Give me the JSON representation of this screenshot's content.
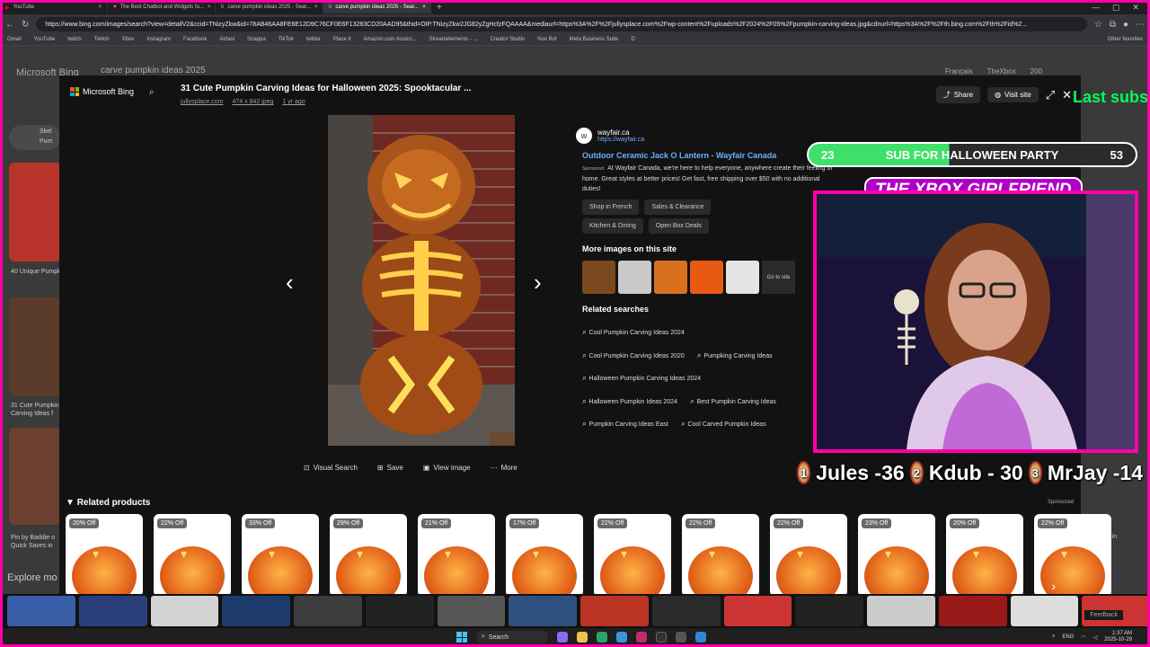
{
  "browser": {
    "tabs": [
      {
        "label": "YouTube",
        "active": false
      },
      {
        "label": "The Best Chatbot and Widgets fo...",
        "active": false
      },
      {
        "label": "carve pumpkin ideas 2025 - Sear...",
        "active": false
      },
      {
        "label": "carve pumpkin ideas 2025 - Sear...",
        "active": true
      }
    ],
    "new_tab": "+",
    "url": "https://www.bing.com/images/search?view=detailV2&ccid=TNizyZkw&id=78AB46AA8FE6E12D9C76CF0E6F13283CD20AAD95&thid=OIP.TNizyZkw2JG82yZgHcfzFQAAAA&mediaurl=https%3A%2F%2Fjullysplace.com%2Fwp-content%2Fuploads%2F2024%2F05%2Fpumpkin-carving-ideas.jpg&cdnurl=https%3A%2F%2Fth.bing.com%2Fth%2Fid%2...",
    "bookmarks": [
      "Gmail",
      "YouTube",
      "twitch",
      "Twitch",
      "Xbox",
      "Instagram",
      "Facebook",
      "Airtasl",
      "Snappa",
      "TikTok",
      "twitter",
      "Place it",
      "Amazon.com Associ...",
      "Streamelements - ...",
      "Creator Studio",
      "Nox Bot",
      "Meta Business Suite",
      "D"
    ],
    "other_bookmarks": "Other favorites"
  },
  "bing_bg": {
    "logo": "Microsoft Bing",
    "query": "carve pumpkin ideas 2025",
    "lang": "Français",
    "user": "TheXbox",
    "points": "200",
    "left_labels": [
      "Skel",
      "Pum",
      "40 Unique Pumpkin",
      "31 Cute Pumpkin Carving Ideas f",
      "Pin by Baddie o Quick Saves in",
      "Explore mo"
    ],
    "right_label": "01 Best in"
  },
  "lightbox": {
    "brand": "Microsoft Bing",
    "title": "31 Cute Pumpkin Carving Ideas for Halloween 2025: Spooktacular ...",
    "source": "jullysplace.com",
    "dimensions": "474 x 842 jpeg",
    "age": "1 yr ago",
    "share_label": "Share",
    "visit_label": "Visit site",
    "tools": [
      "Visual Search",
      "Save",
      "View image",
      "More"
    ]
  },
  "ad": {
    "favicon_letter": "w",
    "name": "wayfair.ca",
    "url": "https://wayfair.ca",
    "title": "Outdoor Ceramic Jack O Lantern - Wayfair Canada",
    "sponsored": "Sponsored",
    "description": "At Wayfair Canada, we're here to help everyone, anywhere create their feeling of home. Great styles at better prices! Get fast, free shipping over $50 with no additional duties!",
    "chips": [
      "Shop in French",
      "Sales & Clearance",
      "Kitchen & Dining",
      "Open Box Deals"
    ]
  },
  "more_images": {
    "heading": "More images on this site",
    "go_to_site": "Go to site",
    "thumb_colors": [
      "#7a4a1e",
      "#c9c9c9",
      "#d8701e",
      "#e85a12",
      "#e4e4e4"
    ]
  },
  "related_searches": {
    "heading": "Related searches",
    "rows": [
      [
        "Cool Pumpkin Carving Ideas 2024"
      ],
      [
        "Cool Pumpkin Carving Ideas 2020",
        "Pumpking Carving Ideas"
      ],
      [
        "Halloween Pumpkin Carving Ideas 2024"
      ],
      [
        "Halloween Pumpkin Ideas 2024",
        "Best Pumpkin Carving Ideas"
      ],
      [
        "Pumpkin Carving Ideas East",
        "Cool Carved Pumpkin Ideas"
      ]
    ]
  },
  "related_products": {
    "heading": "Related products",
    "sponsored": "Sponsored",
    "discounts": [
      "20% Off",
      "22% Off",
      "33% Off",
      "29% Off",
      "21% Off",
      "17% Off",
      "22% Off",
      "22% Off",
      "22% Off",
      "23% Off",
      "20% Off",
      "22% Off"
    ]
  },
  "overlay": {
    "last_sub": "Last subs",
    "goal_current": "23",
    "goal_text": "SUB FOR HALLOWEEN PARTY",
    "goal_target": "53",
    "goal_progress": 0.43,
    "brand_banner": "THE XBOX GIRLFRIEND",
    "leaders": [
      {
        "rank": "1",
        "text": "Jules -36"
      },
      {
        "rank": "2",
        "text": "Kdub - 30"
      },
      {
        "rank": "3",
        "text": "MrJay -14"
      }
    ]
  },
  "bottom": {
    "strip_colors": [
      "#3a5da8",
      "#2a3f7a",
      "#d3d3d3",
      "#1d3a6d",
      "#3d3d3d",
      "#222",
      "#555",
      "#2f4f7f",
      "#b32",
      "#2a2a2a",
      "#c33",
      "#222",
      "#ccc",
      "#9a1a1a",
      "#ddd",
      "#c33"
    ],
    "feedback": "Feedback"
  },
  "taskbar": {
    "search": "Search",
    "lang": "ENG",
    "time": "1:37 AM",
    "date": "2025-10-29"
  }
}
